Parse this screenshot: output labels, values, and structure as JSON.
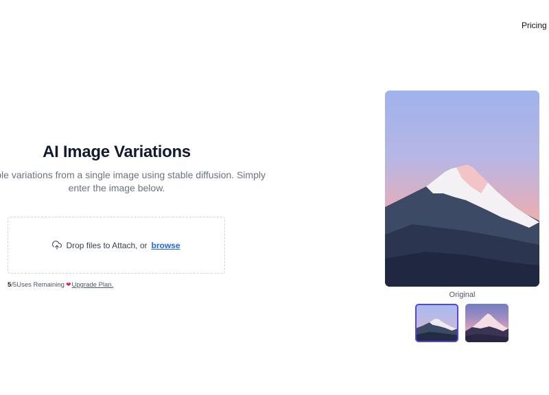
{
  "nav": {
    "pricing_label": "Pricing"
  },
  "hero": {
    "title": "AI Image Variations",
    "subtitle": "e multiple variations from a single image using stable diffusion. Simply enter the image below."
  },
  "upload": {
    "text": "Drop files to Attach, or",
    "link": "browse",
    "icon": "upload-cloud-icon"
  },
  "usage": {
    "remaining": "5",
    "total": "/5",
    "label": " Uses Remaining",
    "heart_icon": "heart-icon",
    "upgrade_label": "Upgrade Plan."
  },
  "preview": {
    "caption": "Original",
    "selected_thumbnail": 0
  },
  "colors": {
    "accent": "#4f46e5",
    "link": "#2563eb",
    "heart": "#e11d48",
    "title": "#141a2e"
  }
}
